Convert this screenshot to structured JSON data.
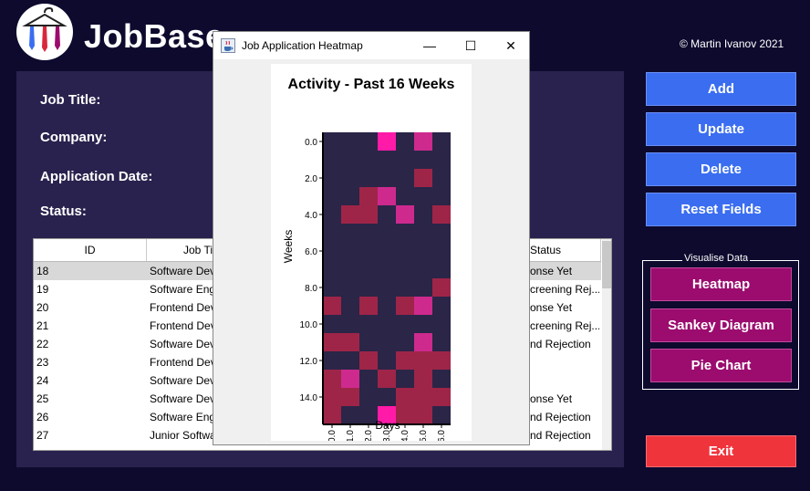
{
  "app": {
    "title": "JobBase",
    "copyright": "© Martin Ivanov 2021"
  },
  "form": {
    "job_title_label": "Job Title:",
    "company_label": "Company:",
    "application_date_label": "Application Date:",
    "status_label": "Status:"
  },
  "table": {
    "headers": [
      "ID",
      "Job Ti",
      "Status"
    ],
    "rows": [
      {
        "id": "18",
        "title": "Software Dev",
        "status": "onse Yet"
      },
      {
        "id": "19",
        "title": "Software Eng",
        "status": "creening Rej..."
      },
      {
        "id": "20",
        "title": "Frontend Dev",
        "status": "onse Yet"
      },
      {
        "id": "21",
        "title": "Frontend Dev",
        "status": "creening Rej..."
      },
      {
        "id": "22",
        "title": "Software Dev",
        "status": "nd Rejection"
      },
      {
        "id": "23",
        "title": "Frontend Dev",
        "status": ""
      },
      {
        "id": "24",
        "title": "Software Dev",
        "status": ""
      },
      {
        "id": "25",
        "title": "Software Dev",
        "status": "onse Yet"
      },
      {
        "id": "26",
        "title": "Software Eng",
        "status": "nd Rejection"
      },
      {
        "id": "27",
        "title": "Junior Softwa",
        "status": "nd Rejection"
      }
    ],
    "selected_row": 0
  },
  "buttons": {
    "add": "Add",
    "update": "Update",
    "delete": "Delete",
    "reset": "Reset Fields",
    "exit": "Exit"
  },
  "visualise": {
    "legend": "Visualise Data",
    "heatmap": "Heatmap",
    "sankey": "Sankey Diagram",
    "pie": "Pie Chart"
  },
  "dialog": {
    "title": "Job Application Heatmap",
    "minimize": "—",
    "maximize": "☐",
    "close": "✕"
  },
  "colors": {
    "background": "#0d0a2e",
    "panel": "#29224e",
    "blue_button": "#3a6df0",
    "magenta_button": "#9b0c6e",
    "red_button": "#f0343c",
    "heat_0": "#2b2548",
    "heat_1": "#9e2548",
    "heat_2": "#ce2a8e",
    "heat_3": "#ff1aa8"
  },
  "chart_data": {
    "type": "heatmap",
    "title": "Activity - Past 16 Weeks",
    "xlabel": "Days",
    "ylabel": "Weeks",
    "x_ticks": [
      "0.0",
      "1.0",
      "2.0",
      "3.0",
      "4.0",
      "5.0",
      "6.0"
    ],
    "y_ticks": [
      "0.0",
      "2.0",
      "4.0",
      "6.0",
      "8.0",
      "10.0",
      "12.0",
      "14.0"
    ],
    "x_categories": [
      0,
      1,
      2,
      3,
      4,
      5,
      6
    ],
    "y_categories": [
      0,
      1,
      2,
      3,
      4,
      5,
      6,
      7,
      8,
      9,
      10,
      11,
      12,
      13,
      14,
      15
    ],
    "values": [
      [
        0,
        0,
        0,
        3,
        0,
        2,
        0
      ],
      [
        0,
        0,
        0,
        0,
        0,
        0,
        0
      ],
      [
        0,
        0,
        0,
        0,
        0,
        1,
        0
      ],
      [
        0,
        0,
        1,
        2,
        0,
        0,
        0
      ],
      [
        0,
        1,
        1,
        0,
        2,
        0,
        1
      ],
      [
        0,
        0,
        0,
        0,
        0,
        0,
        0
      ],
      [
        0,
        0,
        0,
        0,
        0,
        0,
        0
      ],
      [
        0,
        0,
        0,
        0,
        0,
        0,
        0
      ],
      [
        0,
        0,
        0,
        0,
        0,
        0,
        1
      ],
      [
        1,
        0,
        1,
        0,
        1,
        2,
        0
      ],
      [
        0,
        0,
        0,
        0,
        0,
        0,
        0
      ],
      [
        1,
        1,
        0,
        0,
        0,
        2,
        0
      ],
      [
        0,
        0,
        1,
        0,
        1,
        1,
        1
      ],
      [
        1,
        2,
        0,
        1,
        0,
        1,
        0
      ],
      [
        1,
        1,
        0,
        0,
        1,
        1,
        1
      ],
      [
        1,
        0,
        0,
        3,
        1,
        1,
        0
      ]
    ]
  }
}
